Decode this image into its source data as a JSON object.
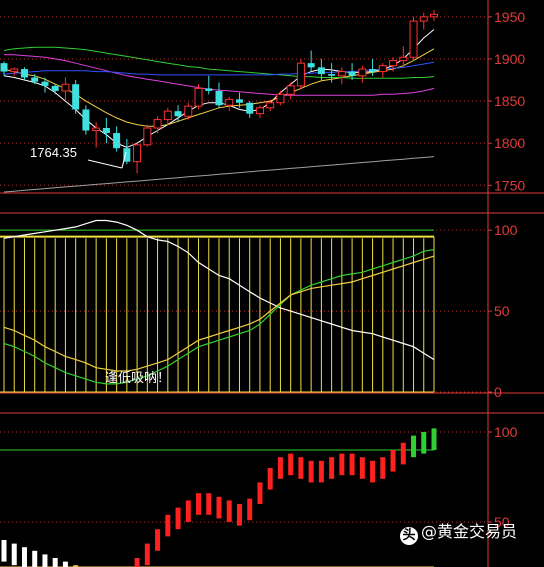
{
  "chart_data": [
    {
      "type": "candlestick",
      "y_ticks": [
        1750,
        1800,
        1850,
        1900,
        1950
      ],
      "ylim": [
        1742,
        1970
      ],
      "annotation": "1764.35",
      "candles": [
        [
          1895,
          1897,
          1880,
          1885
        ],
        [
          1885,
          1890,
          1880,
          1888
        ],
        [
          1888,
          1890,
          1875,
          1878
        ],
        [
          1878,
          1882,
          1870,
          1873
        ],
        [
          1873,
          1878,
          1860,
          1868
        ],
        [
          1868,
          1870,
          1858,
          1862
        ],
        [
          1862,
          1878,
          1850,
          1870
        ],
        [
          1870,
          1875,
          1835,
          1840
        ],
        [
          1840,
          1845,
          1810,
          1815
        ],
        [
          1815,
          1825,
          1795,
          1818
        ],
        [
          1818,
          1830,
          1800,
          1812
        ],
        [
          1812,
          1820,
          1790,
          1794
        ],
        [
          1794,
          1805,
          1775,
          1778
        ],
        [
          1778,
          1800,
          1764,
          1798
        ],
        [
          1798,
          1822,
          1796,
          1818
        ],
        [
          1818,
          1832,
          1812,
          1828
        ],
        [
          1828,
          1842,
          1822,
          1838
        ],
        [
          1838,
          1845,
          1825,
          1832
        ],
        [
          1832,
          1848,
          1828,
          1844
        ],
        [
          1844,
          1870,
          1840,
          1865
        ],
        [
          1865,
          1880,
          1858,
          1862
        ],
        [
          1862,
          1872,
          1842,
          1845
        ],
        [
          1845,
          1855,
          1838,
          1852
        ],
        [
          1852,
          1860,
          1842,
          1848
        ],
        [
          1848,
          1850,
          1830,
          1835
        ],
        [
          1835,
          1845,
          1830,
          1842
        ],
        [
          1842,
          1852,
          1838,
          1848
        ],
        [
          1848,
          1862,
          1845,
          1858
        ],
        [
          1858,
          1872,
          1852,
          1868
        ],
        [
          1868,
          1900,
          1865,
          1895
        ],
        [
          1895,
          1910,
          1885,
          1890
        ],
        [
          1890,
          1900,
          1875,
          1882
        ],
        [
          1882,
          1895,
          1872,
          1880
        ],
        [
          1880,
          1890,
          1870,
          1885
        ],
        [
          1885,
          1895,
          1875,
          1880
        ],
        [
          1880,
          1892,
          1872,
          1888
        ],
        [
          1888,
          1900,
          1880,
          1885
        ],
        [
          1885,
          1895,
          1878,
          1892
        ],
        [
          1892,
          1902,
          1885,
          1898
        ],
        [
          1898,
          1915,
          1890,
          1902
        ],
        [
          1902,
          1950,
          1898,
          1945
        ],
        [
          1945,
          1955,
          1935,
          1950
        ],
        [
          1950,
          1958,
          1945,
          1953
        ]
      ],
      "ma_lines": [
        {
          "color": "#ffffff",
          "values": [
            1880,
            1878,
            1875,
            1872,
            1868,
            1860,
            1850,
            1840,
            1828,
            1818,
            1810,
            1800,
            1795,
            1800,
            1808,
            1815,
            1822,
            1830,
            1838,
            1845,
            1848,
            1848,
            1845,
            1840,
            1838,
            1840,
            1848,
            1860,
            1870,
            1880,
            1885,
            1888,
            1887,
            1885,
            1884,
            1884,
            1885,
            1888,
            1892,
            1900,
            1912,
            1925,
            1935
          ]
        },
        {
          "color": "#f0d040",
          "values": [
            1888,
            1885,
            1882,
            1880,
            1876,
            1870,
            1865,
            1858,
            1850,
            1843,
            1836,
            1830,
            1825,
            1822,
            1820,
            1820,
            1822,
            1826,
            1830,
            1834,
            1838,
            1842,
            1844,
            1845,
            1846,
            1848,
            1850,
            1855,
            1860,
            1865,
            1870,
            1874,
            1876,
            1878,
            1880,
            1882,
            1884,
            1886,
            1888,
            1892,
            1898,
            1905,
            1912
          ]
        },
        {
          "color": "#e040e0",
          "values": [
            1905,
            1905,
            1904,
            1903,
            1902,
            1900,
            1898,
            1895,
            1892,
            1889,
            1886,
            1883,
            1880,
            1878,
            1876,
            1874,
            1872,
            1870,
            1868,
            1866,
            1864,
            1863,
            1862,
            1861,
            1860,
            1859,
            1858,
            1857,
            1857,
            1857,
            1857,
            1857,
            1857,
            1857,
            1857,
            1857,
            1857,
            1858,
            1858,
            1859,
            1860,
            1862,
            1865
          ]
        },
        {
          "color": "#30d030",
          "values": [
            1910,
            1912,
            1913,
            1914,
            1914,
            1914,
            1913,
            1912,
            1911,
            1909,
            1907,
            1905,
            1903,
            1901,
            1899,
            1897,
            1895,
            1893,
            1891,
            1890,
            1888,
            1887,
            1886,
            1885,
            1884,
            1883,
            1882,
            1881,
            1880,
            1879,
            1879,
            1878,
            1878,
            1878,
            1877,
            1877,
            1877,
            1877,
            1877,
            1877,
            1878,
            1878,
            1879
          ]
        },
        {
          "color": "#3050ff",
          "values": [
            1882,
            1883,
            1884,
            1885,
            1886,
            1886,
            1886,
            1886,
            1886,
            1885,
            1885,
            1884,
            1883,
            1882,
            1882,
            1881,
            1881,
            1881,
            1881,
            1881,
            1881,
            1881,
            1881,
            1881,
            1881,
            1881,
            1881,
            1882,
            1882,
            1883,
            1883,
            1884,
            1884,
            1885,
            1885,
            1886,
            1887,
            1888,
            1889,
            1890,
            1892,
            1894,
            1896
          ]
        },
        {
          "color": "#a0a0a0",
          "values": [
            1742,
            1743,
            1744,
            1745,
            1746,
            1747,
            1748,
            1749,
            1750,
            1751,
            1752,
            1753,
            1754,
            1755,
            1756,
            1757,
            1758,
            1759,
            1760,
            1761,
            1762,
            1763,
            1764,
            1765,
            1766,
            1767,
            1768,
            1769,
            1770,
            1771,
            1772,
            1773,
            1774,
            1775,
            1776,
            1777,
            1778,
            1779,
            1780,
            1781,
            1782,
            1783,
            1784
          ]
        }
      ]
    },
    {
      "type": "bar",
      "y_ticks": [
        0,
        50,
        100
      ],
      "ylim": [
        0,
        110
      ],
      "annotation": "逢低吸呐！",
      "bars": [
        95,
        95,
        95,
        95,
        95,
        95,
        95,
        95,
        95,
        95,
        95,
        95,
        95,
        95,
        95,
        95,
        95,
        95,
        95,
        95,
        95,
        95,
        95,
        95,
        95,
        95,
        95,
        95,
        95,
        95,
        95,
        95,
        95,
        95,
        95,
        95,
        95,
        95,
        95,
        95,
        95,
        95,
        96
      ],
      "lines": [
        {
          "color": "#ffffff",
          "values": [
            95,
            96,
            97,
            98,
            99,
            100,
            101,
            102,
            104,
            106,
            106,
            105,
            103,
            100,
            96,
            94,
            93,
            90,
            86,
            80,
            76,
            72,
            70,
            66,
            62,
            58,
            55,
            52,
            50,
            48,
            46,
            44,
            42,
            40,
            38,
            37,
            36,
            34,
            32,
            30,
            28,
            24,
            20
          ]
        },
        {
          "color": "#30d030",
          "values": [
            30,
            28,
            25,
            22,
            18,
            15,
            12,
            10,
            8,
            6,
            5,
            5,
            6,
            8,
            10,
            13,
            16,
            20,
            24,
            28,
            30,
            32,
            34,
            36,
            38,
            42,
            48,
            54,
            60,
            63,
            66,
            68,
            70,
            72,
            73,
            74,
            76,
            78,
            80,
            82,
            84,
            87,
            88
          ]
        },
        {
          "color": "#f0d040",
          "values": [
            40,
            38,
            35,
            32,
            28,
            25,
            22,
            20,
            18,
            15,
            14,
            13,
            13,
            14,
            16,
            18,
            20,
            24,
            28,
            32,
            34,
            36,
            38,
            40,
            42,
            45,
            50,
            55,
            60,
            62,
            64,
            65,
            66,
            67,
            68,
            70,
            72,
            74,
            76,
            78,
            80,
            82,
            84
          ]
        }
      ],
      "reference_lines": [
        {
          "color": "#30d030",
          "value": 100
        }
      ]
    },
    {
      "type": "bar",
      "y_ticks": [
        50,
        100
      ],
      "ylim": [
        25,
        110
      ],
      "histogram": [
        {
          "value": 40,
          "color": "#ffffff"
        },
        {
          "value": 38,
          "color": "#ffffff"
        },
        {
          "value": 36,
          "color": "#ffffff"
        },
        {
          "value": 34,
          "color": "#ffffff"
        },
        {
          "value": 32,
          "color": "#ffffff"
        },
        {
          "value": 30,
          "color": "#ffffff"
        },
        {
          "value": 28,
          "color": "#ffffff"
        },
        {
          "value": 26,
          "color": "#f0d040"
        },
        {
          "value": 25,
          "color": "#f0d040"
        },
        {
          "value": 24,
          "color": "#f0d040"
        },
        {
          "value": 24,
          "color": "#f0d040"
        },
        {
          "value": 25,
          "color": "#f0d040"
        },
        {
          "value": 25,
          "color": "#f0d040"
        },
        {
          "value": 30,
          "color": "#ff2020"
        },
        {
          "value": 38,
          "color": "#ff2020"
        },
        {
          "value": 46,
          "color": "#ff2020"
        },
        {
          "value": 54,
          "color": "#ff2020"
        },
        {
          "value": 58,
          "color": "#ff2020"
        },
        {
          "value": 62,
          "color": "#ff2020"
        },
        {
          "value": 66,
          "color": "#ff2020"
        },
        {
          "value": 66,
          "color": "#ff2020"
        },
        {
          "value": 64,
          "color": "#ff2020"
        },
        {
          "value": 62,
          "color": "#ff2020"
        },
        {
          "value": 60,
          "color": "#ff2020"
        },
        {
          "value": 63,
          "color": "#ff2020"
        },
        {
          "value": 72,
          "color": "#ff2020"
        },
        {
          "value": 80,
          "color": "#ff2020"
        },
        {
          "value": 86,
          "color": "#ff2020"
        },
        {
          "value": 88,
          "color": "#ff2020"
        },
        {
          "value": 86,
          "color": "#ff2020"
        },
        {
          "value": 84,
          "color": "#ff2020"
        },
        {
          "value": 84,
          "color": "#ff2020"
        },
        {
          "value": 86,
          "color": "#ff2020"
        },
        {
          "value": 88,
          "color": "#ff2020"
        },
        {
          "value": 88,
          "color": "#ff2020"
        },
        {
          "value": 86,
          "color": "#ff2020"
        },
        {
          "value": 84,
          "color": "#ff2020"
        },
        {
          "value": 86,
          "color": "#ff2020"
        },
        {
          "value": 90,
          "color": "#ff2020"
        },
        {
          "value": 94,
          "color": "#ff2020"
        },
        {
          "value": 98,
          "color": "#30d030"
        },
        {
          "value": 100,
          "color": "#30d030"
        },
        {
          "value": 102,
          "color": "#30d030"
        }
      ],
      "reference_lines": [
        {
          "color": "#30d030",
          "value": 90
        },
        {
          "color": "#f0d040",
          "value": 25
        }
      ]
    }
  ],
  "watermark": {
    "logo": "头",
    "text": "@黄金交易员"
  },
  "colors": {
    "background": "#000000",
    "axis": "#e03a3a",
    "up": "#ff3030",
    "down": "#40e0e0"
  }
}
